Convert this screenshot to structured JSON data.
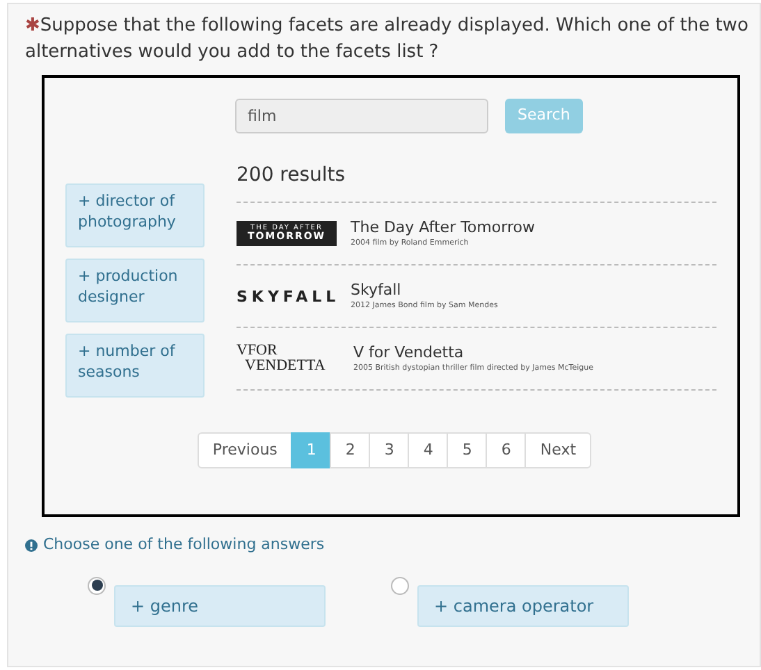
{
  "question": {
    "marker": "✱",
    "text": "Suppose that the following facets are already displayed. Which one of the two alternatives would you add to the facets list ?"
  },
  "search": {
    "value": "film",
    "button": "Search"
  },
  "facets": [
    {
      "label": "+ director of photography"
    },
    {
      "label": "+ production designer"
    },
    {
      "label": "+ number of seasons"
    }
  ],
  "results_count": "200 results",
  "results": [
    {
      "kind": "boxed",
      "logo": [
        "THE DAY AFTER",
        "TOMORROW"
      ],
      "title": "The Day After Tomorrow",
      "description": "2004 film by Roland Emmerich"
    },
    {
      "kind": "spaced",
      "logo": [
        "SKYFALL"
      ],
      "title": "Skyfall",
      "description": "2012 James Bond film by Sam Mendes"
    },
    {
      "kind": "stacked",
      "logo": [
        "VFOR",
        "VENDETTA"
      ],
      "title": "V for Vendetta",
      "description": "2005 British dystopian thriller film directed by James McTeigue"
    }
  ],
  "pagination": [
    {
      "label": "Previous",
      "selected": false
    },
    {
      "label": "1",
      "selected": true
    },
    {
      "label": "2",
      "selected": false
    },
    {
      "label": "3",
      "selected": false
    },
    {
      "label": "4",
      "selected": false
    },
    {
      "label": "5",
      "selected": false
    },
    {
      "label": "6",
      "selected": false
    },
    {
      "label": "Next",
      "selected": false
    }
  ],
  "instruction": "Choose one of the following answers",
  "answers": [
    {
      "label": "+ genre",
      "selected": true
    },
    {
      "label": "+ camera operator",
      "selected": false
    }
  ]
}
